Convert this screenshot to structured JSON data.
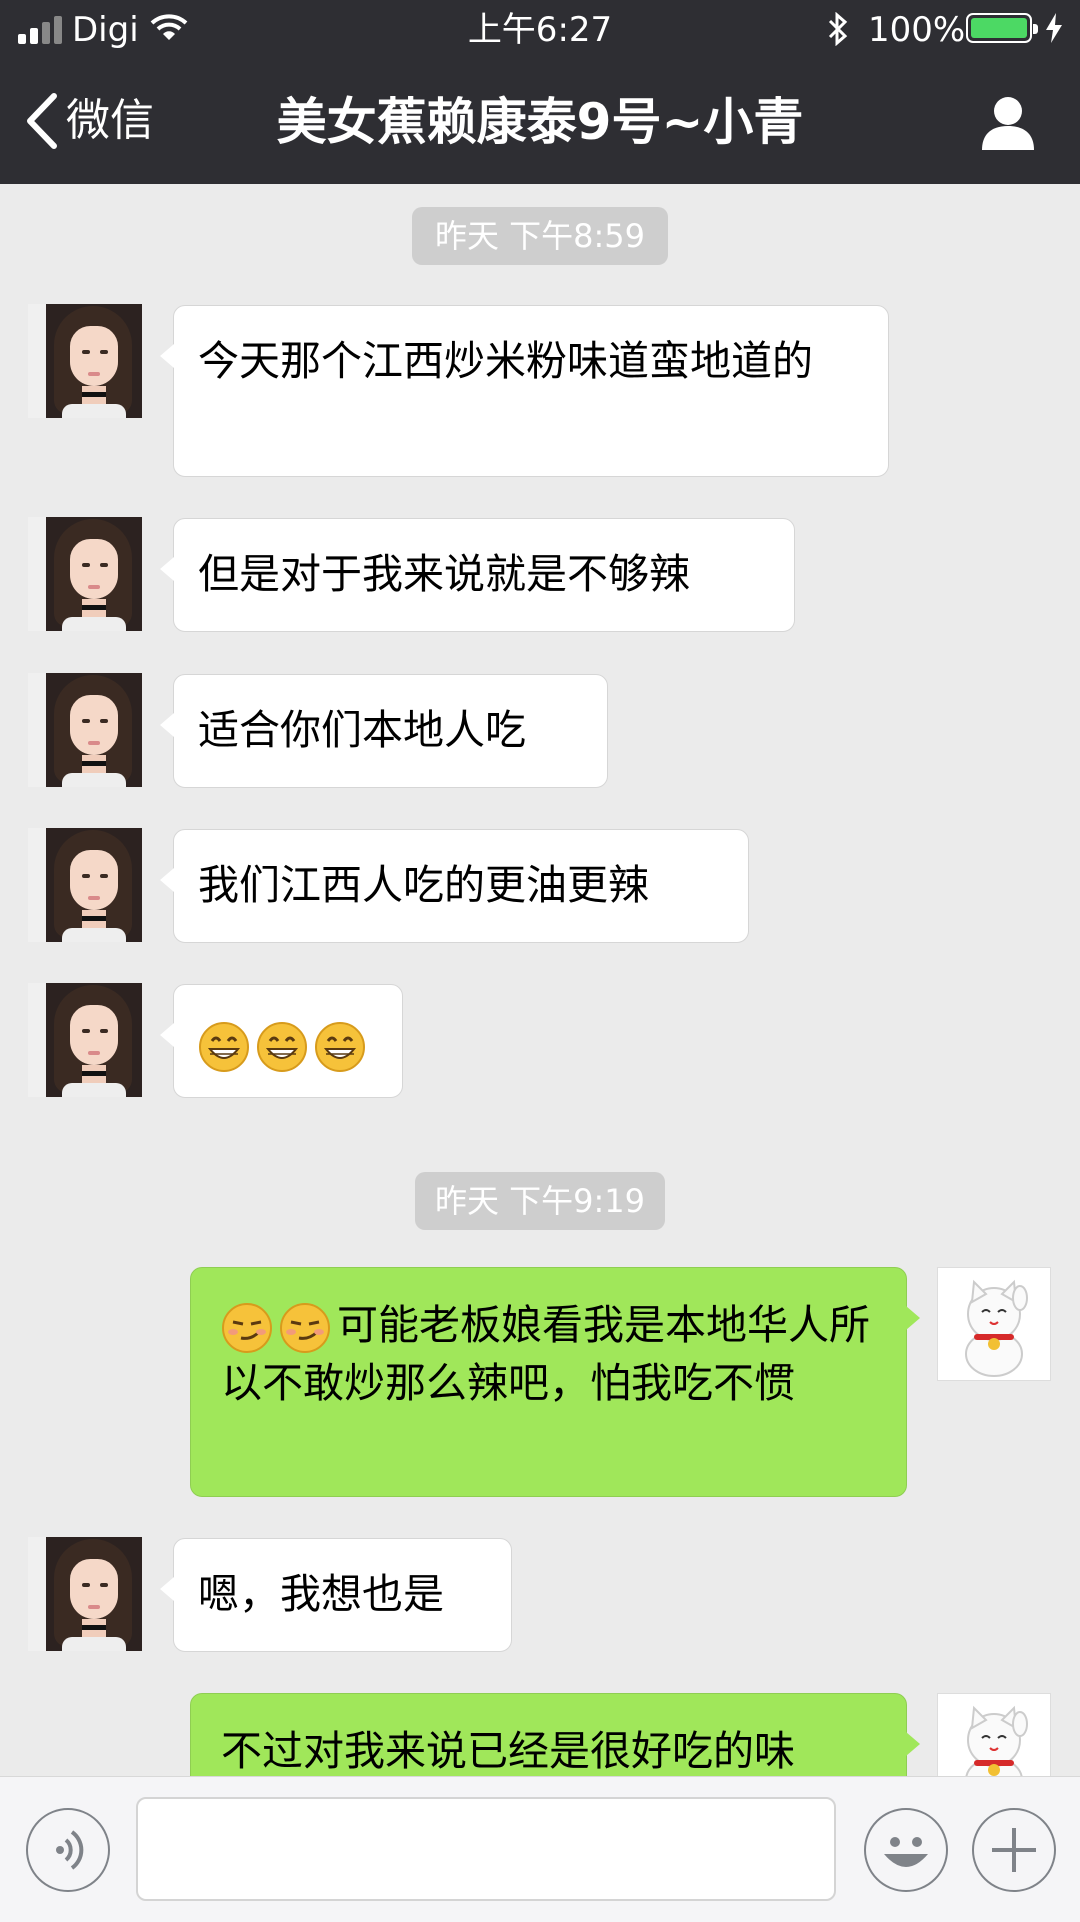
{
  "status_bar": {
    "carrier": "Digi",
    "time": "上午6:27",
    "battery": "100%",
    "battery_level": 1.0
  },
  "nav": {
    "back_label": "微信",
    "title": "美女蕉赖康泰9号~小青"
  },
  "colors": {
    "header_bg": "#2e2e33",
    "chat_bg": "#ebebeb",
    "incoming_bubble": "#ffffff",
    "outgoing_bubble": "#a0e75a",
    "timestamp_bg": "#cecece"
  },
  "chat": {
    "timestamps": [
      "昨天 下午8:59",
      "昨天 下午9:19"
    ],
    "messages": [
      {
        "sender": "contact",
        "text": "今天那个江西炒米粉味道蛮地道的"
      },
      {
        "sender": "contact",
        "text": "但是对于我来说就是不够辣"
      },
      {
        "sender": "contact",
        "text": "适合你们本地人吃"
      },
      {
        "sender": "contact",
        "text": "我们江西人吃的更油更辣"
      },
      {
        "sender": "contact",
        "emojis": [
          "grin-emoji",
          "grin-emoji",
          "grin-emoji"
        ]
      },
      {
        "sender": "me",
        "emojis": [
          "smirk-emoji",
          "smirk-emoji"
        ],
        "text": "可能老板娘看我是本地华人所以不敢炒那么辣吧，怕我吃不惯"
      },
      {
        "sender": "contact",
        "text": "嗯，我想也是"
      },
      {
        "sender": "me",
        "text": "不过对我来说已经是很好吃的味"
      }
    ]
  },
  "input": {
    "placeholder": "",
    "icons": [
      "voice-icon",
      "emoji-icon",
      "plus-icon"
    ]
  }
}
